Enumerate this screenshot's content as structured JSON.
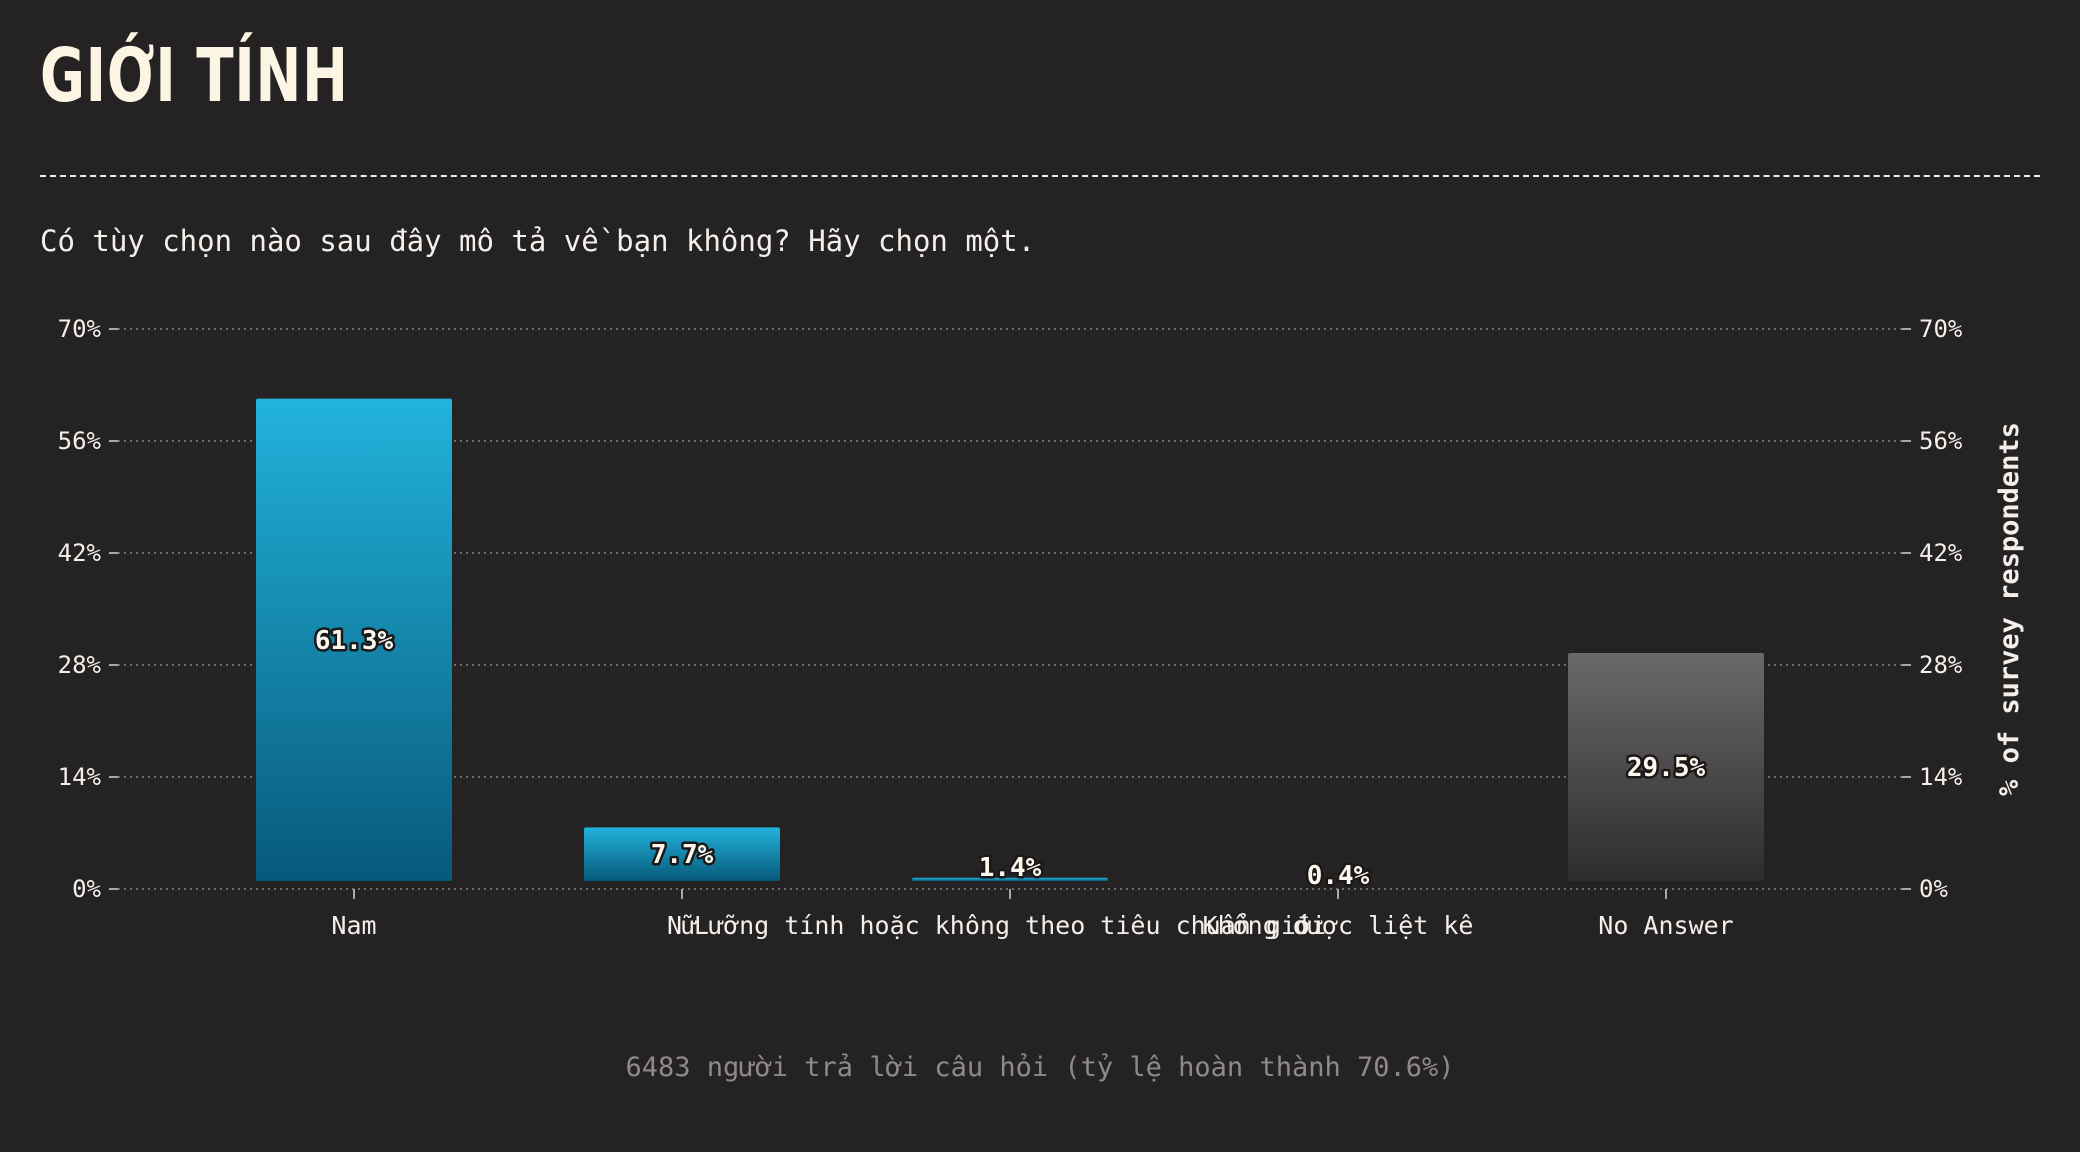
{
  "header": {
    "title": "GIỚI TÍNH",
    "question": "Có tùy chọn nào sau đây mô tả về bạn không? Hãy chọn một."
  },
  "footer": {
    "note": "6483 người trả lời câu hỏi (tỷ lệ hoàn thành 70.6%)"
  },
  "colors": {
    "background": "#252223",
    "bar_answer_top": "#22b3dc",
    "bar_answer_bottom": "#07597a",
    "bar_no_answer_top": "#6a6868",
    "bar_no_answer_bottom": "#2f2c2d",
    "grid": "#8a8784"
  },
  "chart_data": {
    "type": "bar",
    "categories": [
      "Nam",
      "Nữ",
      "Lưỡng tính hoặc không theo tiêu chuẩn giới",
      "Không được liệt kê",
      "No Answer"
    ],
    "values": [
      61.3,
      7.7,
      1.4,
      0.4,
      29.5
    ],
    "value_labels": [
      "61.3%",
      "7.7%",
      "1.4%",
      "0.4%",
      "29.5%"
    ],
    "ylabel_right": "% of survey respondents",
    "ylim": [
      0,
      70
    ],
    "yticks": [
      0,
      14,
      28,
      42,
      56,
      70
    ],
    "ytick_labels": [
      "0%",
      "14%",
      "28%",
      "42%",
      "56%",
      "70%"
    ],
    "grid": true,
    "dual_y_axis": true
  }
}
